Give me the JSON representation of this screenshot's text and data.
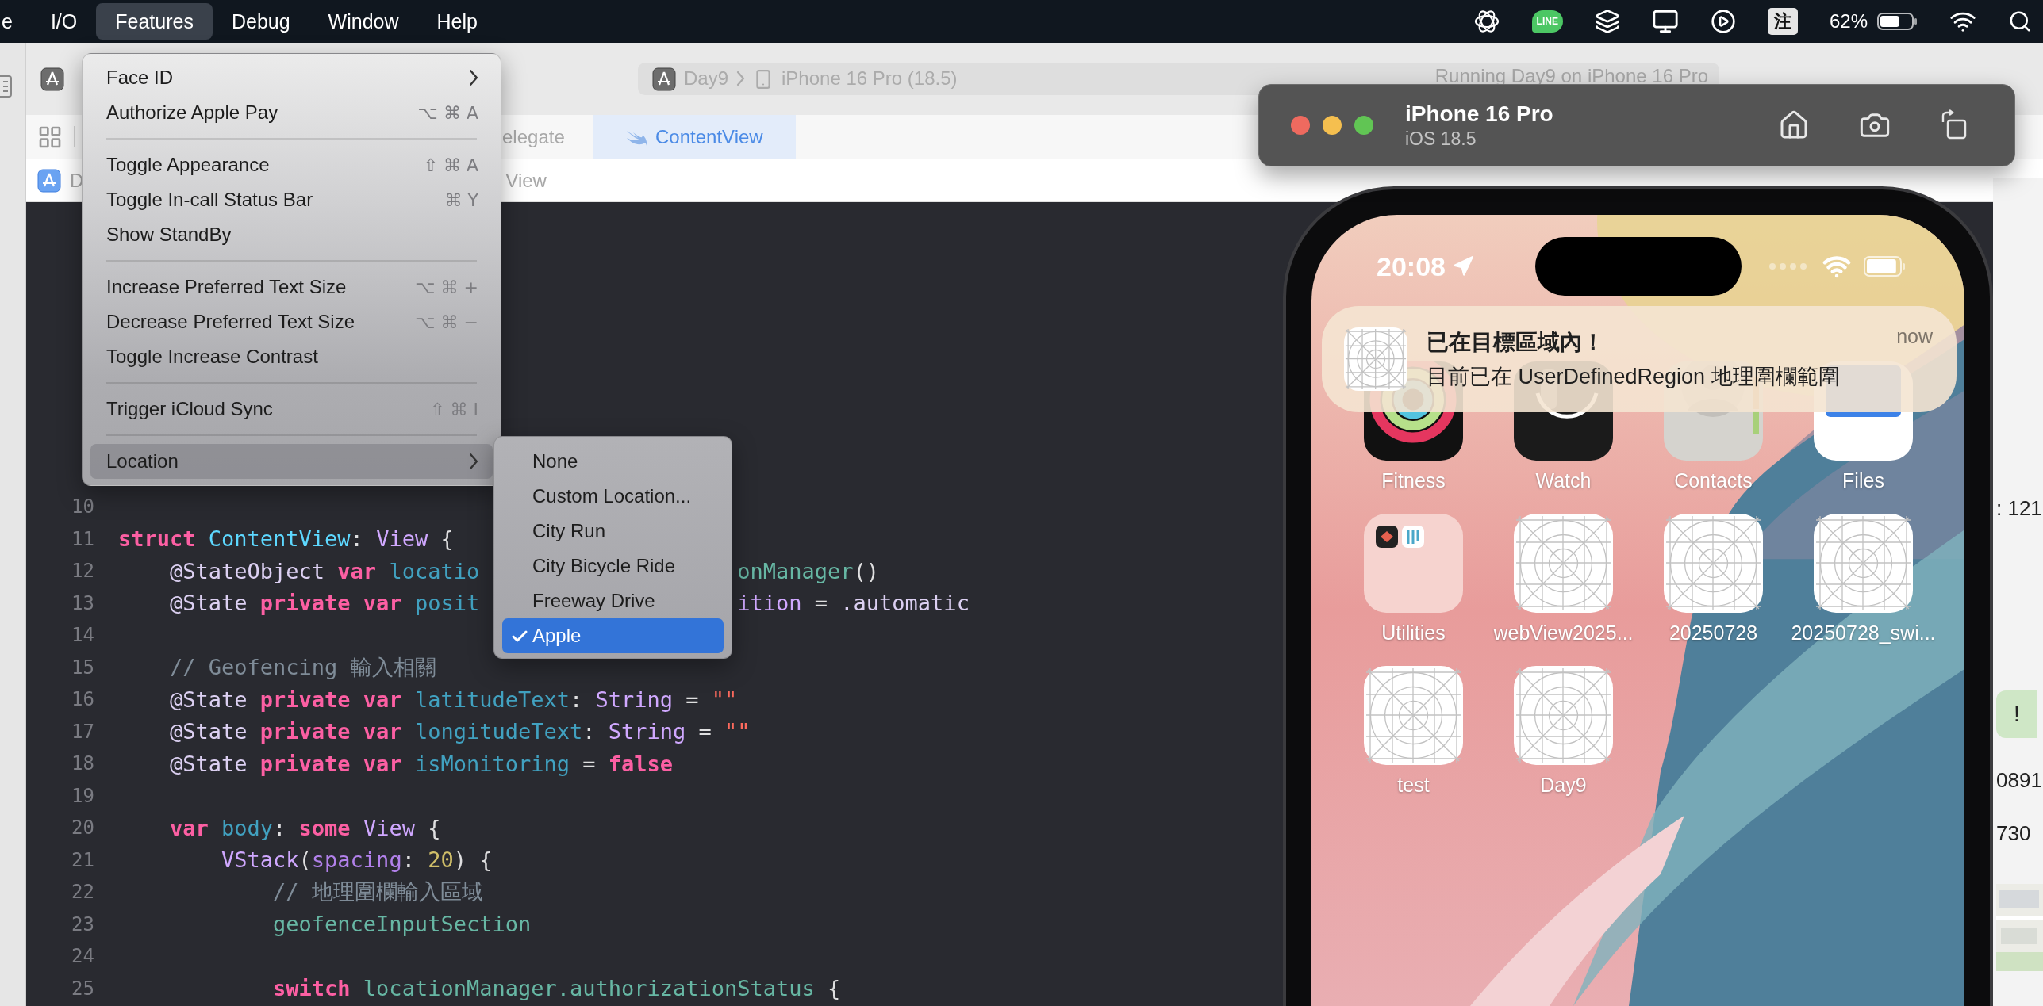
{
  "menu_bar": {
    "items": [
      {
        "label": "e",
        "selected": false
      },
      {
        "label": "I/O",
        "selected": false
      },
      {
        "label": "Features",
        "selected": true
      },
      {
        "label": "Debug",
        "selected": false
      },
      {
        "label": "Window",
        "selected": false
      },
      {
        "label": "Help",
        "selected": false
      }
    ],
    "line_badge": "LINE",
    "input_method": "注",
    "battery": "62%"
  },
  "xcode": {
    "scheme": "Day9",
    "destination": "iPhone 16 Pro (18.5)",
    "activity": "Running Day9 on iPhone 16 Pro",
    "tabs": [
      {
        "label": "elegate",
        "selected": false,
        "kind": "plain"
      },
      {
        "label": "ContentView",
        "selected": true,
        "kind": "swift"
      }
    ],
    "jump_bar": [
      "D",
      "View"
    ],
    "code": [
      {
        "n": "10"
      },
      {
        "n": "11",
        "t": [
          {
            "kind": "kw",
            "text": "struct "
          },
          {
            "kind": "typedecl",
            "text": "ContentView"
          },
          {
            "kind": "plain",
            "text": ": "
          },
          {
            "kind": "type",
            "text": "View"
          },
          {
            "kind": "plain",
            "text": " {"
          }
        ]
      },
      {
        "n": "12",
        "t": [
          {
            "kind": "attr",
            "text": "    @StateObject "
          },
          {
            "kind": "kw",
            "text": "var "
          },
          {
            "kind": "decl",
            "text": "locatio"
          },
          {
            "kind": "hidden"
          },
          {
            "kind": "prop",
            "text": "onManager"
          },
          {
            "kind": "plain",
            "text": "()"
          }
        ]
      },
      {
        "n": "13",
        "t": [
          {
            "kind": "attr",
            "text": "    @State "
          },
          {
            "kind": "kw",
            "text": "private "
          },
          {
            "kind": "kw",
            "text": "var "
          },
          {
            "kind": "decl",
            "text": "posit"
          },
          {
            "kind": "hidden"
          },
          {
            "kind": "type",
            "text": "ition"
          },
          {
            "kind": "plain",
            "text": " = "
          },
          {
            "kind": "attr",
            "text": ".automatic"
          }
        ]
      },
      {
        "n": "14"
      },
      {
        "n": "15",
        "t": [
          {
            "kind": "comment",
            "text": "    // Geofencing 輸入相關"
          }
        ]
      },
      {
        "n": "16",
        "t": [
          {
            "kind": "attr",
            "text": "    @State "
          },
          {
            "kind": "kw",
            "text": "private "
          },
          {
            "kind": "kw",
            "text": "var "
          },
          {
            "kind": "decl",
            "text": "latitudeText"
          },
          {
            "kind": "plain",
            "text": ": "
          },
          {
            "kind": "type",
            "text": "String"
          },
          {
            "kind": "plain",
            "text": " = "
          },
          {
            "kind": "str",
            "text": "\"\""
          }
        ]
      },
      {
        "n": "17",
        "t": [
          {
            "kind": "attr",
            "text": "    @State "
          },
          {
            "kind": "kw",
            "text": "private "
          },
          {
            "kind": "kw",
            "text": "var "
          },
          {
            "kind": "decl",
            "text": "longitudeText"
          },
          {
            "kind": "plain",
            "text": ": "
          },
          {
            "kind": "type",
            "text": "String"
          },
          {
            "kind": "plain",
            "text": " = "
          },
          {
            "kind": "str",
            "text": "\"\""
          }
        ]
      },
      {
        "n": "18",
        "t": [
          {
            "kind": "attr",
            "text": "    @State "
          },
          {
            "kind": "kw",
            "text": "private "
          },
          {
            "kind": "kw",
            "text": "var "
          },
          {
            "kind": "decl",
            "text": "isMonitoring"
          },
          {
            "kind": "plain",
            "text": " = "
          },
          {
            "kind": "kw",
            "text": "false"
          }
        ]
      },
      {
        "n": "19"
      },
      {
        "n": "20",
        "t": [
          {
            "kind": "kw",
            "text": "    var "
          },
          {
            "kind": "decl",
            "text": "body"
          },
          {
            "kind": "plain",
            "text": ": "
          },
          {
            "kind": "kw",
            "text": "some "
          },
          {
            "kind": "type",
            "text": "View"
          },
          {
            "kind": "plain",
            "text": " {"
          }
        ]
      },
      {
        "n": "21",
        "t": [
          {
            "kind": "type",
            "text": "        VStack"
          },
          {
            "kind": "plain",
            "text": "("
          },
          {
            "kind": "param",
            "text": "spacing"
          },
          {
            "kind": "plain",
            "text": ": "
          },
          {
            "kind": "num",
            "text": "20"
          },
          {
            "kind": "plain",
            "text": ") {"
          }
        ]
      },
      {
        "n": "22",
        "t": [
          {
            "kind": "comment",
            "text": "            // 地理圍欄輸入區域"
          }
        ]
      },
      {
        "n": "23",
        "t": [
          {
            "kind": "prop",
            "text": "            geofenceInputSection"
          }
        ]
      },
      {
        "n": "24"
      },
      {
        "n": "25",
        "t": [
          {
            "kind": "kw",
            "text": "            switch "
          },
          {
            "kind": "prop",
            "text": "locationManager.authorizationStatus"
          },
          {
            "kind": "plain",
            "text": " {"
          }
        ]
      }
    ]
  },
  "features_menu": [
    {
      "kind": "item",
      "label": "Face ID",
      "submenu": true,
      "selected": false
    },
    {
      "kind": "item",
      "label": "Authorize Apple Pay",
      "shortcut": "⌥ ⌘ A",
      "submenu": false,
      "selected": false
    },
    {
      "kind": "separator"
    },
    {
      "kind": "item",
      "label": "Toggle Appearance",
      "shortcut": "⇧ ⌘ A",
      "submenu": false,
      "selected": false
    },
    {
      "kind": "item",
      "label": "Toggle In-call Status Bar",
      "shortcut": "⌘ Y",
      "submenu": false,
      "selected": false
    },
    {
      "kind": "item",
      "label": "Show StandBy",
      "submenu": false,
      "selected": false
    },
    {
      "kind": "separator"
    },
    {
      "kind": "item",
      "label": "Increase Preferred Text Size",
      "shortcut": "⌥ ⌘ +",
      "submenu": false,
      "selected": false
    },
    {
      "kind": "item",
      "label": "Decrease Preferred Text Size",
      "shortcut": "⌥ ⌘ −",
      "submenu": false,
      "selected": false
    },
    {
      "kind": "item",
      "label": "Toggle Increase Contrast",
      "submenu": false,
      "selected": false
    },
    {
      "kind": "separator"
    },
    {
      "kind": "item",
      "label": "Trigger iCloud Sync",
      "shortcut": "⇧ ⌘ I",
      "submenu": false,
      "selected": false
    },
    {
      "kind": "separator"
    },
    {
      "kind": "item",
      "label": "Location",
      "submenu": true,
      "selected": true
    }
  ],
  "location_menu": [
    {
      "label": "None",
      "checked": false,
      "selected": false
    },
    {
      "label": "Custom Location...",
      "checked": false,
      "selected": false
    },
    {
      "label": "City Run",
      "checked": false,
      "selected": false
    },
    {
      "label": "City Bicycle Ride",
      "checked": false,
      "selected": false
    },
    {
      "label": "Freeway Drive",
      "checked": false,
      "selected": false
    },
    {
      "label": "Apple",
      "checked": true,
      "selected": true
    }
  ],
  "simulator": {
    "title": "iPhone 16 Pro",
    "subtitle": "iOS 18.5",
    "time": "20:08",
    "notification": {
      "title": "已在目標區域內！",
      "body": "目前已在 UserDefinedRegion 地理圍欄範圍",
      "time": "now"
    },
    "apps": [
      {
        "label": "Fitness",
        "kind": "fitness"
      },
      {
        "label": "Watch",
        "kind": "watch"
      },
      {
        "label": "Contacts",
        "kind": "contacts"
      },
      {
        "label": "Files",
        "kind": "files"
      },
      {
        "label": "Utilities",
        "kind": "folder"
      },
      {
        "label": "webView2025...",
        "kind": "placeholder"
      },
      {
        "label": "20250728",
        "kind": "placeholder"
      },
      {
        "label": "20250728_swi...",
        "kind": "placeholder"
      },
      {
        "label": "test",
        "kind": "placeholder"
      },
      {
        "label": "Day9",
        "kind": "placeholder"
      }
    ]
  },
  "side_window": [
    {
      "kind": "text",
      "text": ": 121"
    },
    {
      "kind": "bubble",
      "text": "!"
    },
    {
      "kind": "text",
      "text": "0891"
    },
    {
      "kind": "text",
      "text": "730"
    },
    {
      "kind": "map"
    }
  ]
}
